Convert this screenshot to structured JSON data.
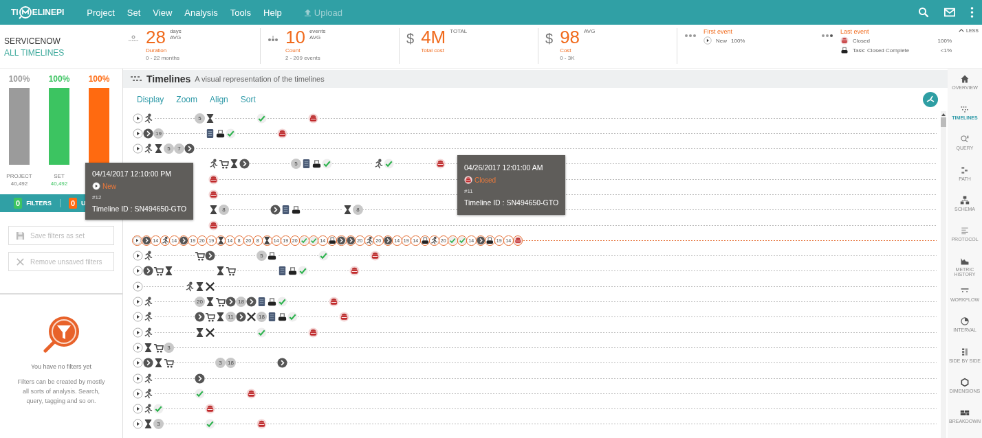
{
  "app_bar": {
    "logo": {
      "left": "TI",
      "right": "ELINEPI"
    },
    "menu": [
      {
        "label": "Project",
        "disabled": false
      },
      {
        "label": "Set",
        "disabled": false
      },
      {
        "label": "View",
        "disabled": false
      },
      {
        "label": "Analysis",
        "disabled": false
      },
      {
        "label": "Tools",
        "disabled": false
      },
      {
        "label": "Help",
        "disabled": false
      },
      {
        "label": "Upload",
        "disabled": true
      }
    ]
  },
  "context": {
    "project": "SERVICENOW",
    "set": "ALL TIMELINES"
  },
  "kpis": [
    {
      "kind": "duration",
      "value": "28",
      "unit": "days",
      "qualifier": "AVG",
      "label": "Duration",
      "range": "0 - 22 months"
    },
    {
      "kind": "count",
      "value": "10",
      "unit": "events",
      "qualifier": "AVG",
      "label": "Count",
      "range": "2 - 209 events"
    },
    {
      "kind": "money",
      "symbol": "$",
      "value": "4M",
      "qualifier": "TOTAL",
      "label": "Total cost"
    },
    {
      "kind": "money",
      "symbol": "$",
      "value": "98",
      "qualifier": "AVG",
      "label": "Cost",
      "range": "0 - 3K"
    }
  ],
  "first_event": {
    "title": "First event",
    "items": [
      {
        "kind": "start",
        "label": "New",
        "share": "100%"
      }
    ]
  },
  "last_event": {
    "title": "Last event",
    "items": [
      {
        "kind": "closed",
        "label": "Closed",
        "share": "100%"
      },
      {
        "kind": "task",
        "label": "Task: Closed Complete",
        "share": "<1%"
      }
    ]
  },
  "less_toggle": "LESS",
  "coverage": [
    {
      "percent": "100%",
      "level": 1,
      "color": "#9b9b9b",
      "name": "PROJECT",
      "count": "40,492"
    },
    {
      "percent": "100%",
      "level": 1,
      "color": "#3cc461",
      "name": "SET",
      "count": "40,492"
    },
    {
      "percent": "100%",
      "level": 1,
      "color": "#ff6a10"
    }
  ],
  "filter_bar": [
    {
      "count": "0",
      "label": "FILTERS",
      "color": "#3cc461"
    },
    {
      "count": "0",
      "label": "U",
      "color": "#ff6a10"
    }
  ],
  "filter_actions": [
    {
      "kind": "save",
      "label": "Save filters as set",
      "disabled": true
    },
    {
      "kind": "remove",
      "label": "Remove unsaved filters",
      "disabled": true
    }
  ],
  "empty_state": {
    "title": "You have no filters yet",
    "text": "Filters can be created by mostly all sorts of analysis. Search, query, tagging and so on."
  },
  "timelines": {
    "title": "Timelines",
    "subtitle": "A visual representation of the timelines",
    "toolbar": [
      "Display",
      "Zoom",
      "Align",
      "Sort"
    ],
    "rows": [
      {
        "selected": false,
        "groups": [
          [
            {
              "kind": "start"
            },
            {
              "kind": "runner"
            }
          ],
          [
            {
              "kind": "count",
              "text": "5"
            },
            {
              "kind": "hourglass"
            }
          ],
          [
            {
              "kind": "check"
            }
          ],
          [
            {
              "kind": "closed"
            }
          ]
        ]
      },
      {
        "selected": false,
        "groups": [
          [
            {
              "kind": "start"
            },
            {
              "kind": "next"
            },
            {
              "kind": "count",
              "text": "19"
            }
          ],
          [
            {
              "kind": "file"
            },
            {
              "kind": "task"
            },
            {
              "kind": "check"
            }
          ],
          [
            {
              "kind": "closed"
            }
          ]
        ]
      },
      {
        "selected": false,
        "groups": [
          [
            {
              "kind": "start"
            },
            {
              "kind": "runner"
            },
            {
              "kind": "hourglass"
            },
            {
              "kind": "count",
              "text": "5"
            },
            {
              "kind": "count",
              "text": "7"
            },
            {
              "kind": "next"
            }
          ]
        ]
      },
      {
        "selected": false,
        "groups": [
          [
            {
              "kind": "runner"
            },
            {
              "kind": "cart"
            },
            {
              "kind": "hourglass"
            },
            {
              "kind": "next"
            }
          ],
          [
            {
              "kind": "count",
              "text": "5"
            },
            {
              "kind": "file"
            },
            {
              "kind": "task"
            },
            {
              "kind": "check"
            }
          ],
          [
            {
              "kind": "runner"
            },
            {
              "kind": "check"
            }
          ],
          [
            {
              "kind": "closed"
            }
          ]
        ]
      },
      {
        "selected": false,
        "groups": [
          [
            {
              "kind": "closed"
            }
          ]
        ]
      },
      {
        "selected": false,
        "groups": [
          [
            {
              "kind": "closed"
            }
          ]
        ]
      },
      {
        "selected": false,
        "groups": [
          [
            {
              "kind": "hourglass"
            },
            {
              "kind": "count",
              "text": "8"
            }
          ],
          [
            {
              "kind": "next"
            },
            {
              "kind": "file"
            },
            {
              "kind": "task"
            }
          ],
          [
            {
              "kind": "hourglass"
            },
            {
              "kind": "count",
              "text": "8"
            }
          ]
        ]
      },
      {
        "selected": false,
        "groups": [
          [
            {
              "kind": "closed"
            }
          ]
        ]
      },
      {
        "selected": true,
        "groups": [
          [
            {
              "kind": "start"
            },
            {
              "kind": "next"
            },
            {
              "kind": "count",
              "text": "14"
            },
            {
              "kind": "runner"
            },
            {
              "kind": "count",
              "text": "14"
            },
            {
              "kind": "next"
            },
            {
              "kind": "count",
              "text": "19"
            },
            {
              "kind": "count",
              "text": "20"
            },
            {
              "kind": "count",
              "text": "19"
            },
            {
              "kind": "hourglass"
            },
            {
              "kind": "count",
              "text": "14"
            },
            {
              "kind": "count",
              "text": "8"
            },
            {
              "kind": "count",
              "text": "20"
            },
            {
              "kind": "count",
              "text": "8"
            },
            {
              "kind": "hourglass"
            },
            {
              "kind": "count",
              "text": "14"
            },
            {
              "kind": "count",
              "text": "19"
            },
            {
              "kind": "count",
              "text": "20"
            },
            {
              "kind": "check"
            },
            {
              "kind": "check"
            },
            {
              "kind": "count",
              "text": "14"
            },
            {
              "kind": "task"
            },
            {
              "kind": "next"
            },
            {
              "kind": "next"
            },
            {
              "kind": "count",
              "text": "20"
            },
            {
              "kind": "runner"
            },
            {
              "kind": "count",
              "text": "20"
            },
            {
              "kind": "next"
            },
            {
              "kind": "count",
              "text": "14"
            },
            {
              "kind": "count",
              "text": "19"
            },
            {
              "kind": "count",
              "text": "14"
            },
            {
              "kind": "task"
            },
            {
              "kind": "runner"
            },
            {
              "kind": "count",
              "text": "20"
            },
            {
              "kind": "check"
            },
            {
              "kind": "check"
            },
            {
              "kind": "count",
              "text": "14"
            },
            {
              "kind": "next"
            },
            {
              "kind": "task"
            },
            {
              "kind": "count",
              "text": "19"
            },
            {
              "kind": "count",
              "text": "14"
            },
            {
              "kind": "closed"
            }
          ]
        ]
      },
      {
        "selected": false,
        "groups": [
          [
            {
              "kind": "start"
            },
            {
              "kind": "runner"
            }
          ],
          [
            {
              "kind": "cart"
            },
            {
              "kind": "next"
            }
          ],
          [
            {
              "kind": "count",
              "text": "5"
            },
            {
              "kind": "task"
            }
          ],
          [
            {
              "kind": "check"
            }
          ],
          [
            {
              "kind": "closed"
            }
          ]
        ]
      },
      {
        "selected": false,
        "groups": [
          [
            {
              "kind": "start"
            },
            {
              "kind": "next"
            },
            {
              "kind": "cart"
            },
            {
              "kind": "hourglass"
            }
          ],
          [
            {
              "kind": "hourglass"
            },
            {
              "kind": "cart"
            }
          ],
          [
            {
              "kind": "file"
            },
            {
              "kind": "task"
            },
            {
              "kind": "check"
            }
          ],
          [
            {
              "kind": "closed"
            }
          ]
        ]
      },
      {
        "selected": false,
        "groups": [
          [
            {
              "kind": "start"
            }
          ],
          [
            {
              "kind": "runner"
            },
            {
              "kind": "hourglass"
            },
            {
              "kind": "wrench"
            }
          ]
        ]
      },
      {
        "selected": false,
        "groups": [
          [
            {
              "kind": "start"
            },
            {
              "kind": "runner"
            }
          ],
          [
            {
              "kind": "count",
              "text": "20"
            },
            {
              "kind": "hourglass"
            },
            {
              "kind": "cart"
            },
            {
              "kind": "next"
            },
            {
              "kind": "count",
              "text": "18"
            },
            {
              "kind": "next"
            },
            {
              "kind": "file"
            },
            {
              "kind": "task"
            },
            {
              "kind": "check"
            }
          ],
          [
            {
              "kind": "closed"
            }
          ]
        ]
      },
      {
        "selected": false,
        "groups": [
          [
            {
              "kind": "start"
            },
            {
              "kind": "runner"
            }
          ],
          [
            {
              "kind": "next"
            },
            {
              "kind": "cart"
            },
            {
              "kind": "hourglass"
            },
            {
              "kind": "count",
              "text": "11"
            },
            {
              "kind": "next"
            },
            {
              "kind": "wrench"
            },
            {
              "kind": "count",
              "text": "18"
            },
            {
              "kind": "file"
            },
            {
              "kind": "task"
            },
            {
              "kind": "check"
            }
          ],
          [
            {
              "kind": "closed"
            }
          ]
        ]
      },
      {
        "selected": false,
        "groups": [
          [
            {
              "kind": "start"
            },
            {
              "kind": "runner"
            }
          ],
          [
            {
              "kind": "hourglass"
            },
            {
              "kind": "wrench"
            }
          ],
          [
            {
              "kind": "check"
            }
          ],
          [
            {
              "kind": "closed"
            }
          ]
        ]
      },
      {
        "selected": false,
        "groups": [
          [
            {
              "kind": "start"
            },
            {
              "kind": "hourglass"
            },
            {
              "kind": "cart"
            },
            {
              "kind": "count",
              "text": "3"
            }
          ]
        ]
      },
      {
        "selected": false,
        "groups": [
          [
            {
              "kind": "start"
            },
            {
              "kind": "next"
            },
            {
              "kind": "hourglass"
            },
            {
              "kind": "cart"
            }
          ],
          [
            {
              "kind": "count",
              "text": "3"
            },
            {
              "kind": "count",
              "text": "18"
            }
          ],
          [
            {
              "kind": "next"
            }
          ]
        ]
      },
      {
        "selected": false,
        "groups": [
          [
            {
              "kind": "start"
            },
            {
              "kind": "runner"
            }
          ],
          [
            {
              "kind": "next"
            }
          ]
        ]
      },
      {
        "selected": false,
        "groups": [
          [
            {
              "kind": "start"
            },
            {
              "kind": "runner"
            }
          ],
          [
            {
              "kind": "check"
            }
          ],
          [
            {
              "kind": "closed"
            }
          ]
        ]
      },
      {
        "selected": false,
        "groups": [
          [
            {
              "kind": "start"
            },
            {
              "kind": "runner"
            },
            {
              "kind": "check"
            }
          ],
          [
            {
              "kind": "closed"
            }
          ]
        ]
      },
      {
        "selected": false,
        "groups": [
          [
            {
              "kind": "start"
            },
            {
              "kind": "hourglass"
            },
            {
              "kind": "count",
              "text": "3"
            }
          ],
          [
            {
              "kind": "check"
            }
          ],
          [
            {
              "kind": "closed"
            }
          ]
        ]
      }
    ],
    "tooltips": [
      {
        "date": "04/14/2017 12:10:00 PM",
        "event": {
          "kind": "start",
          "label": "New"
        },
        "number": "#12",
        "timeline_id": "Timeline ID : SN494650-GTO"
      },
      {
        "date": "04/26/2017 12:01:00 AM",
        "event": {
          "kind": "closed",
          "label": "Closed"
        },
        "number": "#11",
        "timeline_id": "Timeline ID : SN494650-GTO"
      }
    ]
  },
  "side_nav": [
    {
      "kind": "home",
      "label": "OVERVIEW",
      "selected": false
    },
    {
      "kind": "timelines",
      "label": "TIMELINES",
      "selected": true
    },
    {
      "kind": "query",
      "label": "QUERY",
      "selected": false
    },
    {
      "kind": "path",
      "label": "PATH",
      "selected": false
    },
    {
      "kind": "schema",
      "label": "SCHEMA",
      "selected": false
    },
    {
      "kind": "protocol",
      "label": "PROTOCOL",
      "selected": false
    },
    {
      "kind": "metric",
      "label": "METRIC HISTORY",
      "selected": false
    },
    {
      "kind": "workflow",
      "label": "WORKFLOW",
      "selected": false
    },
    {
      "kind": "interval",
      "label": "INTERVAL",
      "selected": false
    },
    {
      "kind": "side",
      "label": "SIDE BY SIDE",
      "selected": false
    },
    {
      "kind": "dimensions",
      "label": "DIMENSIONS",
      "selected": false
    },
    {
      "kind": "breakdown",
      "label": "BREAKDOWN",
      "selected": false
    }
  ]
}
